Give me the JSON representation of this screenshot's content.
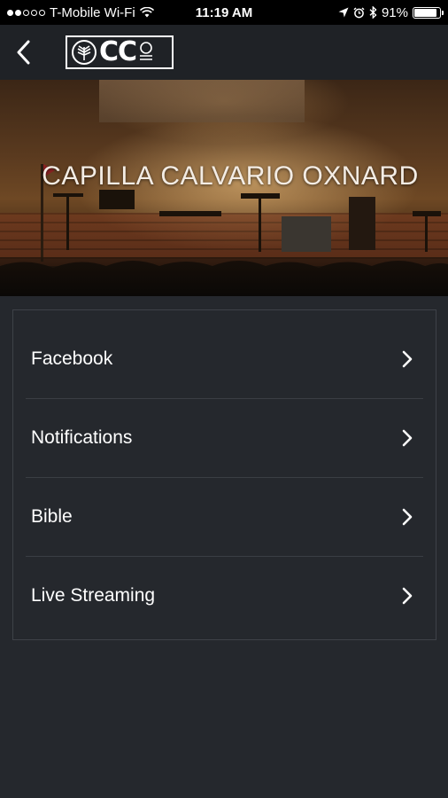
{
  "status_bar": {
    "carrier": "T-Mobile Wi-Fi",
    "time": "11:19 AM",
    "battery": "91%",
    "battery_level": 0.91,
    "signal_bars": 2,
    "signal_total": 5
  },
  "nav": {
    "back_icon": "chevron-left-icon",
    "logo_text": "CC"
  },
  "hero": {
    "title": "CAPILLA CALVARIO OXNARD"
  },
  "menu": {
    "items": [
      {
        "label": "Facebook",
        "icon": "chevron-right-icon"
      },
      {
        "label": "Notifications",
        "icon": "chevron-right-icon"
      },
      {
        "label": "Bible",
        "icon": "chevron-right-icon"
      },
      {
        "label": "Live Streaming",
        "icon": "chevron-right-icon"
      }
    ]
  },
  "colors": {
    "background": "#25282d",
    "nav_background": "#1f2226",
    "status_background": "#000000",
    "text": "#ffffff"
  }
}
